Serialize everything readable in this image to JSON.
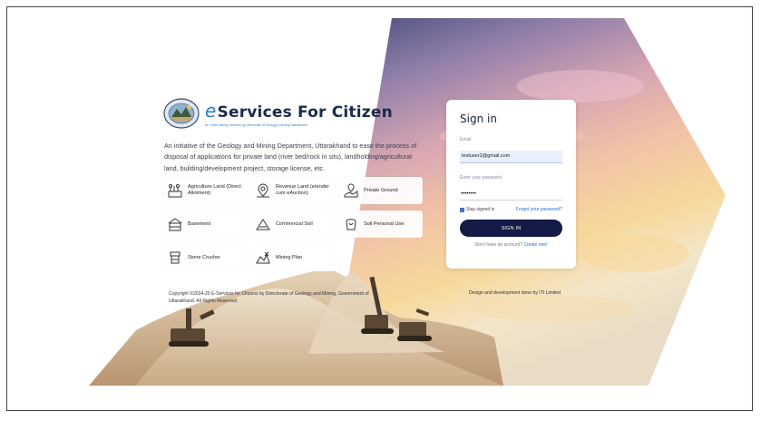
{
  "brand": {
    "title_e": "e",
    "title_rest": "Services For Citizen",
    "subtitle": "An Online Mining Services by Directorate of Geology & Mining Uttarakhand"
  },
  "intro": "An initiative of the Geology and Mining Department, Uttarakhand to ease the process of disposal of applications for private land (river bed/rock in situ), landholding/agricultural land, building/development project, storage license, etc.",
  "services": [
    {
      "label": "Agriculture Land (Direct Allotment)",
      "icon": "agriculture-icon"
    },
    {
      "label": "Revenue Land (etender cum eAuction)",
      "icon": "location-pin-icon"
    },
    {
      "label": "Private Ground",
      "icon": "private-ground-icon"
    },
    {
      "label": "Basement",
      "icon": "basement-icon"
    },
    {
      "label": "Commercial Soil",
      "icon": "commercial-soil-icon"
    },
    {
      "label": "Soil Personal Use",
      "icon": "soil-personal-use-icon"
    },
    {
      "label": "Stone Crusher",
      "icon": "stone-crusher-icon"
    },
    {
      "label": "Mining Plan",
      "icon": "mining-plan-icon"
    }
  ],
  "footer": {
    "copyright": "Copyright ©2024-25 E-Services for Citizens by Directorate of Geology and Mining, Government of Uttarakhand. All Rights Reserved",
    "design": "Design and development done by ITI Limited"
  },
  "signin": {
    "title": "Sign in",
    "email_label": "Email",
    "email_value": "testuser2@gmail.com",
    "password_placeholder": "Enter your password",
    "password_value": "••••••••",
    "stay_signed_in": "Stay signed in",
    "stay_signed_in_checked": true,
    "forgot": "Forgot your password?",
    "button": "SIGN IN",
    "no_account": "Don't have an account?",
    "create": "Create one!"
  },
  "colors": {
    "primary_button": "#141b46",
    "link": "#2a6bd1",
    "brand_blue": "#2a7fd6",
    "email_field_bg": "#e8f0fe"
  }
}
